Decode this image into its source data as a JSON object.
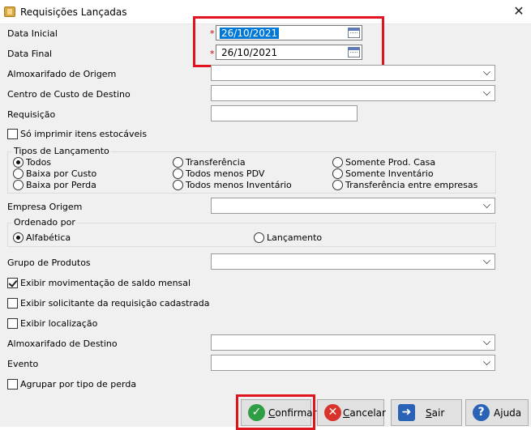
{
  "window": {
    "title": "Requisições Lançadas",
    "close_glyph": "✕"
  },
  "fields": {
    "data_inicial": {
      "label": "Data Inicial",
      "value": "26/10/2021",
      "required_mark": "*"
    },
    "data_final": {
      "label": "Data Final",
      "value": "26/10/2021",
      "required_mark": "*"
    },
    "almox_origem": {
      "label": "Almoxarifado de Origem",
      "value": ""
    },
    "centro_custo": {
      "label": "Centro de Custo de Destino",
      "value": ""
    },
    "requisicao": {
      "label": "Requisição",
      "value": ""
    },
    "empresa_origem": {
      "label": "Empresa Origem",
      "value": ""
    },
    "grupo_produtos": {
      "label": "Grupo de Produtos",
      "value": ""
    },
    "almox_destino": {
      "label": "Almoxarifado de Destino",
      "value": ""
    },
    "evento": {
      "label": "Evento",
      "value": ""
    }
  },
  "checkboxes": {
    "so_estocaveis": {
      "label": "Só imprimir itens estocáveis",
      "checked": false
    },
    "exibir_saldo": {
      "label": "Exibir movimentação de saldo mensal",
      "checked": true
    },
    "exibir_solicitante": {
      "label": "Exibir solicitante da requisição cadastrada",
      "checked": false
    },
    "exibir_localizacao": {
      "label": "Exibir localização",
      "checked": false
    },
    "agrupar_perda": {
      "label": "Agrupar por tipo de perda",
      "checked": false
    }
  },
  "tipos_lancamento": {
    "title": "Tipos de Lançamento",
    "options": [
      {
        "label": "Todos",
        "selected": true
      },
      {
        "label": "Baixa por Custo",
        "selected": false
      },
      {
        "label": "Baixa por Perda",
        "selected": false
      },
      {
        "label": "Transferência",
        "selected": false
      },
      {
        "label": "Todos menos PDV",
        "selected": false
      },
      {
        "label": "Todos menos Inventário",
        "selected": false
      },
      {
        "label": "Somente Prod. Casa",
        "selected": false
      },
      {
        "label": "Somente Inventário",
        "selected": false
      },
      {
        "label": "Transferência entre empresas",
        "selected": false
      }
    ]
  },
  "ordenado_por": {
    "title": "Ordenado por",
    "options": [
      {
        "label": "Alfabética",
        "selected": true
      },
      {
        "label": "Lançamento",
        "selected": false
      }
    ]
  },
  "buttons": {
    "confirmar": {
      "pre": "",
      "u": "C",
      "post": "onfirmar",
      "icon": "check-icon",
      "color": "#2e9e44"
    },
    "cancelar": {
      "pre": "",
      "u": "C",
      "post": "ancelar",
      "icon": "cancel-icon",
      "color": "#d9342b"
    },
    "sair": {
      "pre": "",
      "u": "S",
      "post": "air",
      "icon": "exit-icon",
      "color": "#2a63b6"
    },
    "ajuda": {
      "pre": "A",
      "u": "j",
      "post": "uda",
      "icon": "help-icon",
      "color": "#2a63b6"
    }
  },
  "colors": {
    "highlight": "#e0141e",
    "selection": "#0078d7"
  }
}
